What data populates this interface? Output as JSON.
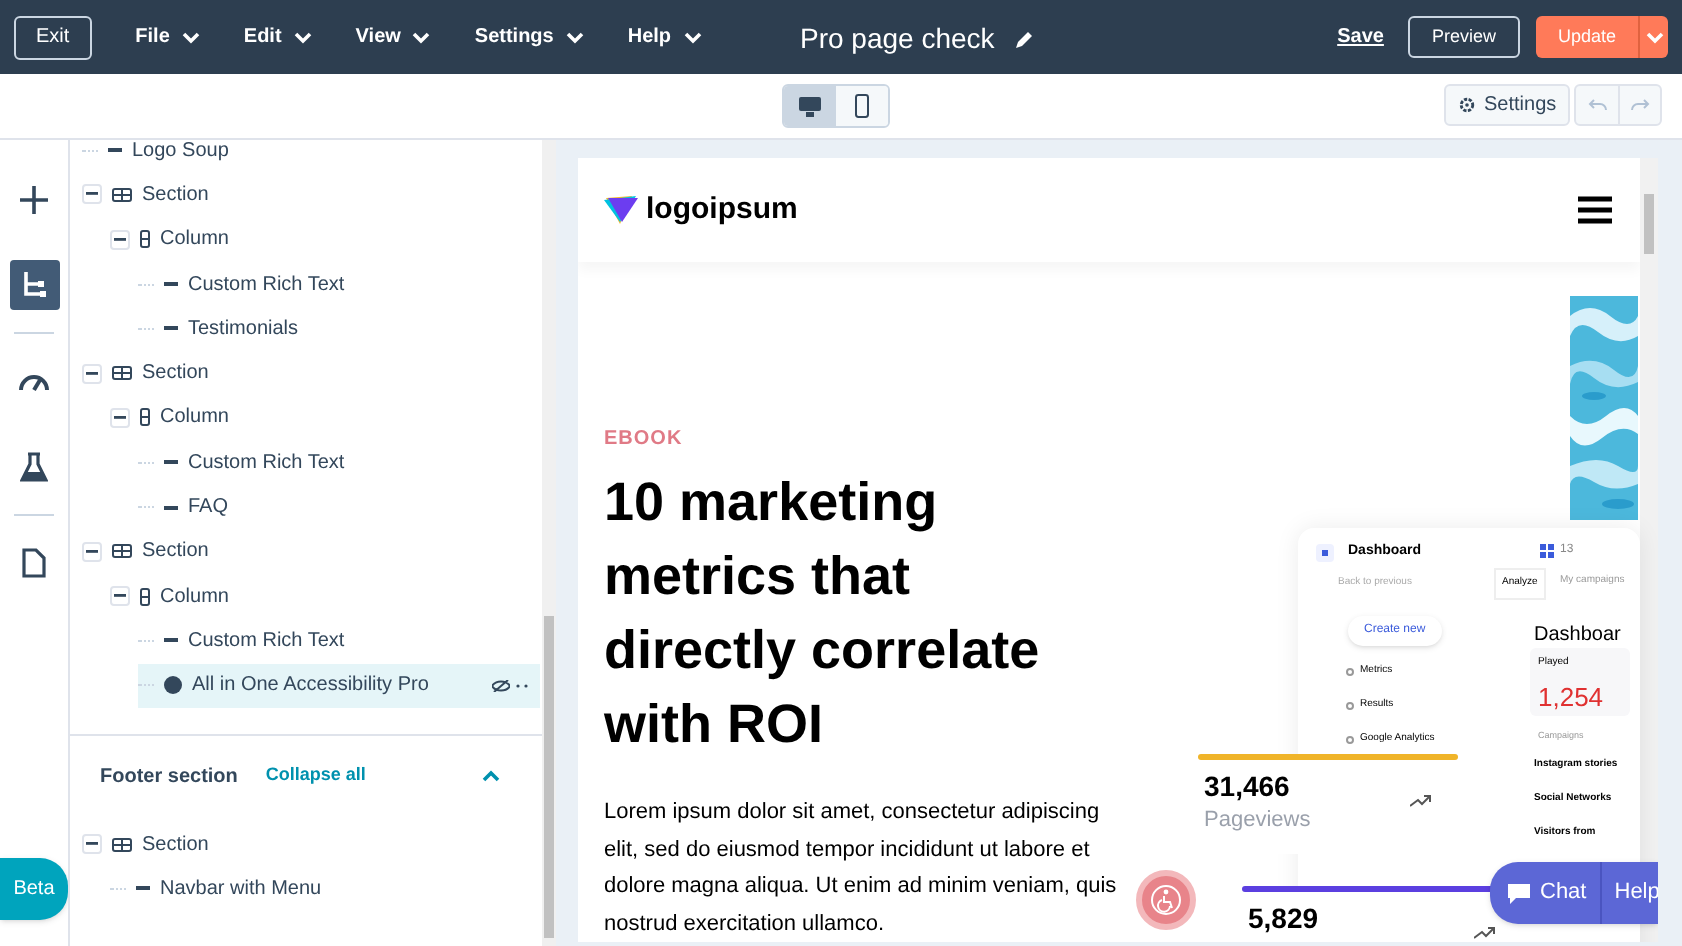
{
  "topbar": {
    "exit": "Exit",
    "menus": [
      "File",
      "Edit",
      "View",
      "Settings",
      "Help"
    ],
    "title": "Pro page check",
    "save": "Save",
    "preview": "Preview",
    "update": "Update"
  },
  "toolbar": {
    "devices": [
      {
        "kind": "desktop",
        "selected": true
      },
      {
        "kind": "mobile",
        "selected": false
      }
    ],
    "settings": "Settings"
  },
  "rail": [
    {
      "kind": "add",
      "selected": false
    },
    {
      "kind": "tree",
      "selected": true
    },
    {
      "kind": "gauge",
      "selected": false
    },
    {
      "kind": "flask",
      "selected": false
    },
    {
      "kind": "page",
      "selected": false
    }
  ],
  "tree": [
    {
      "label": "Logo Soup",
      "kind": "module",
      "selected": false
    },
    {
      "label": "Section",
      "kind": "section",
      "expanded": true,
      "selected": false,
      "children": [
        {
          "label": "Column",
          "kind": "column",
          "expanded": true,
          "selected": false,
          "children": [
            {
              "label": "Custom Rich Text",
              "kind": "module",
              "selected": false
            },
            {
              "label": "Testimonials",
              "kind": "module",
              "selected": false
            }
          ]
        }
      ]
    },
    {
      "label": "Section",
      "kind": "section",
      "expanded": true,
      "selected": false,
      "children": [
        {
          "label": "Column",
          "kind": "column",
          "expanded": true,
          "selected": false,
          "children": [
            {
              "label": "Custom Rich Text",
              "kind": "module",
              "selected": false
            },
            {
              "label": "FAQ",
              "kind": "module",
              "selected": false
            }
          ]
        }
      ]
    },
    {
      "label": "Section",
      "kind": "section",
      "expanded": true,
      "selected": false,
      "children": [
        {
          "label": "Column",
          "kind": "column",
          "expanded": true,
          "selected": false,
          "children": [
            {
              "label": "Custom Rich Text",
              "kind": "module",
              "selected": false
            },
            {
              "label": "All in One Accessibility Pro",
              "kind": "app",
              "selected": true
            }
          ]
        }
      ]
    }
  ],
  "footer": {
    "title": "Footer section",
    "collapse": "Collapse all",
    "expanded": true,
    "tree": [
      {
        "label": "Section",
        "kind": "section",
        "expanded": true,
        "selected": false,
        "children": [
          {
            "label": "Navbar with Menu",
            "kind": "module",
            "selected": false
          }
        ]
      }
    ]
  },
  "beta": "Beta",
  "preview": {
    "logo": "logoipsum",
    "eyebrow": "EBOOK",
    "headline": "10 marketing metrics that directly correlate with ROI",
    "body": "Lorem ipsum dolor sit amet, consectetur adipiscing elit, sed do eiusmod tempor incididunt ut labore et dolore magna aliqua. Ut enim ad minim veniam, quis nostrud exercitation ullamco.",
    "dashboard": {
      "title": "Dashboard",
      "count": "13",
      "back": "Back to previous",
      "tabs": [
        {
          "label": "Analyze",
          "selected": true
        },
        {
          "label": "My campaigns",
          "selected": false
        }
      ],
      "create": "Create new",
      "menu": [
        "Metrics",
        "Results",
        "Google Analytics"
      ],
      "panel_title": "Dashboar",
      "played_label": "Played",
      "played": "1,254",
      "section": "Campaigns",
      "campaigns": [
        "Instagram stories",
        "Social Networks",
        "Visitors from"
      ]
    },
    "stats": [
      {
        "value": "31,466",
        "label": "Pageviews",
        "color": "#f0b429"
      },
      {
        "value": "5,829",
        "color": "#5b3fe0"
      }
    ],
    "chat": "Chat",
    "help": "Help"
  }
}
